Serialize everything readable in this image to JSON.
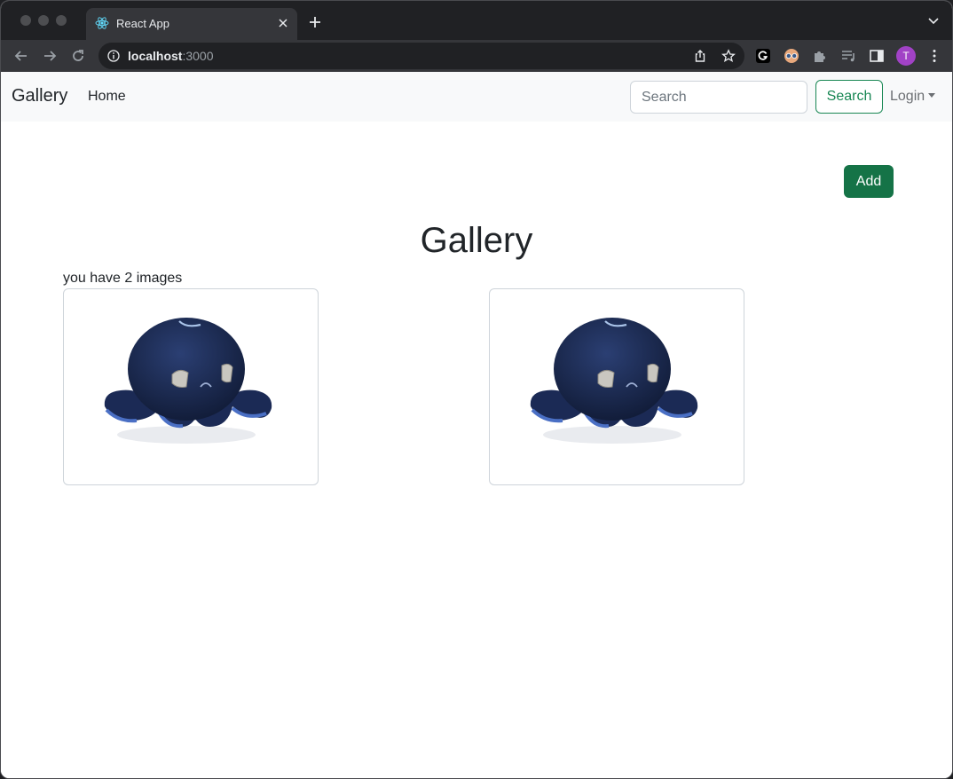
{
  "browser": {
    "tab_title": "React App",
    "url_host": "localhost",
    "url_port": ":3000",
    "profile_initial": "T"
  },
  "navbar": {
    "brand": "Gallery",
    "home_link": "Home",
    "search_placeholder": "Search",
    "search_button": "Search",
    "login_menu": "Login"
  },
  "main": {
    "add_button": "Add",
    "title": "Gallery",
    "count_text": "you have 2 images",
    "images": [
      {
        "subject": "navy octopus plush"
      },
      {
        "subject": "navy octopus plush"
      }
    ]
  },
  "colors": {
    "accent_green": "#198754",
    "add_button_bg": "#157347",
    "navbar_bg": "#f8f9fa",
    "profile_bg": "#a142c6"
  }
}
